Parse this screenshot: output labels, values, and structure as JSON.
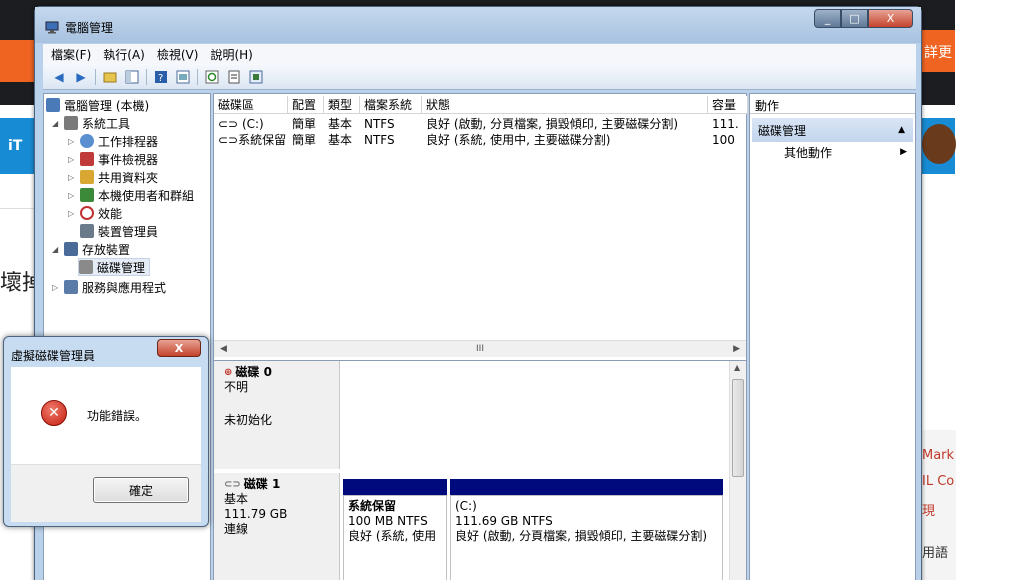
{
  "background": {
    "tab_text": "iT",
    "heading_fragment": "壞掉",
    "orange_text": "詳更",
    "right_texts": [
      "Mark",
      "IL Co",
      "現",
      "用語"
    ]
  },
  "window": {
    "title": "電腦管理",
    "caption": {
      "minimize": "_",
      "maximize": "□",
      "close": "X"
    }
  },
  "menu": [
    "檔案(F)",
    "執行(A)",
    "檢視(V)",
    "說明(H)"
  ],
  "tree": [
    {
      "label": "電腦管理 (本機)",
      "exp": "",
      "icon_color": "#4a7ab8"
    },
    {
      "label": "系統工具",
      "exp": "◢",
      "icon_color": "#7a7a7a"
    },
    {
      "label": "工作排程器",
      "exp": "▷",
      "icon_color": "#5a8fd0"
    },
    {
      "label": "事件檢視器",
      "exp": "▷",
      "icon_color": "#c03a3a"
    },
    {
      "label": "共用資料夾",
      "exp": "▷",
      "icon_color": "#d8a832"
    },
    {
      "label": "本機使用者和群組",
      "exp": "▷",
      "icon_color": "#3a8a3a"
    },
    {
      "label": "效能",
      "exp": "▷",
      "icon_color": "#c03030"
    },
    {
      "label": "裝置管理員",
      "exp": "",
      "icon_color": "#6a7a8a"
    },
    {
      "label": "存放裝置",
      "exp": "◢",
      "icon_color": "#4a6a9a"
    },
    {
      "label": "磁碟管理",
      "exp": "",
      "icon_color": "#8a8a8a"
    },
    {
      "label": "服務與應用程式",
      "exp": "▷",
      "icon_color": "#5a7aa8"
    }
  ],
  "volume_table": {
    "headers": [
      "磁碟區",
      "配置",
      "類型",
      "檔案系統",
      "狀態",
      "容量"
    ],
    "rows": [
      [
        "(C:)",
        "簡單",
        "基本",
        "NTFS",
        "良好 (啟動, 分頁檔案, 損毀傾印, 主要磁碟分割)",
        "111."
      ],
      [
        "系統保留",
        "簡單",
        "基本",
        "NTFS",
        "良好 (系統, 使用中, 主要磁碟分割)",
        "100"
      ]
    ]
  },
  "scrollbar": {
    "thumb_glyph": "III"
  },
  "disks": [
    {
      "title": "磁碟 0",
      "lines": [
        "不明",
        "",
        "未初始化"
      ]
    },
    {
      "title": "磁碟 1",
      "lines": [
        "基本",
        "111.79 GB",
        "連線"
      ]
    }
  ],
  "partitions": [
    {
      "name": "系統保留",
      "size": "100 MB NTFS",
      "status": "良好 (系統, 使用"
    },
    {
      "name": "(C:)",
      "size": "111.69 GB NTFS",
      "status": "良好 (啟動, 分頁檔案, 損毀傾印, 主要磁碟分割)"
    }
  ],
  "actions": {
    "header": "動作",
    "section": "磁碟管理",
    "item": "其他動作"
  },
  "dialog": {
    "title": "虛擬磁碟管理員",
    "message": "功能錯誤。",
    "ok": "確定",
    "close": "X"
  },
  "colors": {
    "partition_bar": "#000a7c",
    "accent": "#b9d1ea"
  }
}
